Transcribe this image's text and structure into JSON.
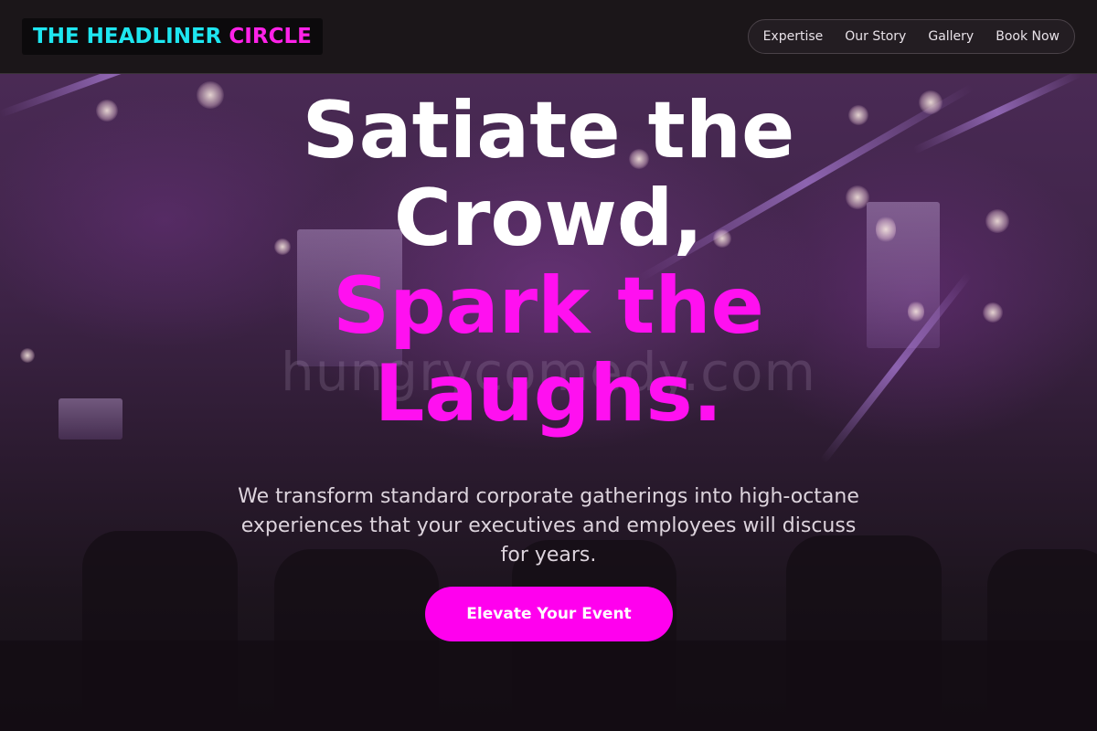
{
  "header": {
    "logo": {
      "part1": "THE HEADLINER",
      "part2": "CIRCLE"
    },
    "nav": [
      "Expertise",
      "Our Story",
      "Gallery",
      "Book Now"
    ]
  },
  "hero": {
    "headline_white": [
      "Satiate the",
      "Crowd,"
    ],
    "headline_pink": [
      "Spark the",
      "Laughs."
    ],
    "subtitle": "We transform standard corporate gatherings into high-octane experiences that your executives and employees will discuss for years.",
    "cta": "Elevate Your Event",
    "watermark": "hungrycomedy.com"
  },
  "colors": {
    "accent_pink": "#ff00ee",
    "accent_cyan": "#1ee6f0",
    "header_bg": "#1b1619"
  }
}
